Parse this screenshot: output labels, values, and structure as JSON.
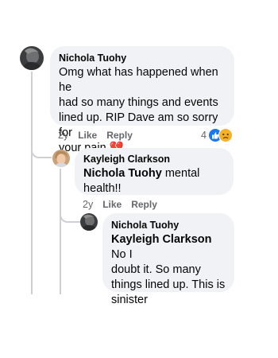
{
  "comments": [
    {
      "author": "Nichola Tuohy",
      "text_lines": [
        "Omg what has happened when he",
        "had so many things and events",
        "lined up. RIP Dave am so sorry for",
        "your pain"
      ],
      "emoji": "💔",
      "time": "2y",
      "like_label": "Like",
      "reply_label": "Reply",
      "reaction_count": "4",
      "reactions": [
        "like",
        "sad"
      ]
    },
    {
      "author": "Kayleigh Clarkson",
      "mention": "Nichola Tuohy",
      "text_lines": [
        " mental",
        "health!!"
      ],
      "time": "2y",
      "like_label": "Like",
      "reply_label": "Reply"
    },
    {
      "author": "Nichola Tuohy",
      "mention": "Kayleigh Clarkson",
      "text_lines": [
        " No I",
        "doubt it. So many",
        "things lined up. This is",
        "sinister"
      ]
    }
  ],
  "colors": {
    "bubble": "#f0f2f5",
    "meta_text": "#65676b",
    "thread_line": "#ced0d4",
    "like_blue": "#1877f2",
    "sad_yellow": "#f7b125",
    "heart_red": "#e0245e"
  }
}
